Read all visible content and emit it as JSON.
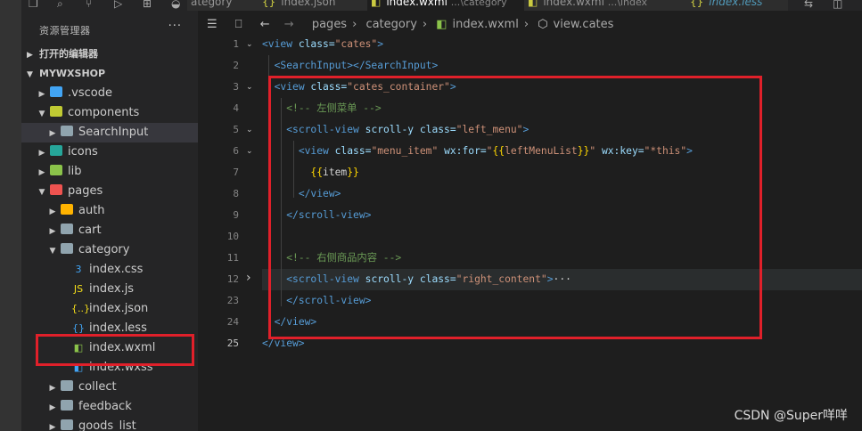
{
  "tabs": [
    {
      "label": "ategory",
      "active": false
    },
    {
      "label": "index.json",
      "icon": "{}",
      "active": false
    },
    {
      "label": "index.wxml",
      "suffix": "...\\category",
      "active": true
    },
    {
      "label": "index.wxml",
      "suffix": "...\\index",
      "active": false
    },
    {
      "label": "index.less",
      "active": false
    }
  ],
  "sidebar": {
    "title": "资源管理器",
    "more": "···",
    "open_editors": "打开的编辑器",
    "project": "MYWXSHOP",
    "items": [
      {
        "label": ".vscode",
        "depth": 1,
        "kind": "folder",
        "icon": "vscode-folder-icon",
        "expanded": false
      },
      {
        "label": "components",
        "depth": 1,
        "kind": "folder",
        "icon": "components-folder-icon",
        "expanded": true
      },
      {
        "label": "SearchInput",
        "depth": 2,
        "kind": "folder",
        "icon": "folder-icon",
        "expanded": false,
        "selected": true
      },
      {
        "label": "icons",
        "depth": 1,
        "kind": "folder",
        "icon": "icons-folder-icon",
        "expanded": false
      },
      {
        "label": "lib",
        "depth": 1,
        "kind": "folder",
        "icon": "lib-folder-icon",
        "expanded": false
      },
      {
        "label": "pages",
        "depth": 1,
        "kind": "folder",
        "icon": "pages-folder-icon",
        "expanded": true
      },
      {
        "label": "auth",
        "depth": 2,
        "kind": "folder",
        "icon": "auth-folder-icon",
        "expanded": false
      },
      {
        "label": "cart",
        "depth": 2,
        "kind": "folder",
        "icon": "folder-icon",
        "expanded": false
      },
      {
        "label": "category",
        "depth": 2,
        "kind": "folder",
        "icon": "folder-open-icon",
        "expanded": true
      },
      {
        "label": "index.css",
        "depth": 3,
        "kind": "file",
        "icon": "css-file-icon",
        "glyph": "3",
        "color": "#42a5f5"
      },
      {
        "label": "index.js",
        "depth": 3,
        "kind": "file",
        "icon": "js-file-icon",
        "glyph": "JS",
        "color": "#f5de19"
      },
      {
        "label": "index.json",
        "depth": 3,
        "kind": "file",
        "icon": "json-file-icon",
        "glyph": "{..}",
        "color": "#f5de19"
      },
      {
        "label": "index.less",
        "depth": 3,
        "kind": "file",
        "icon": "less-file-icon",
        "glyph": "{}",
        "color": "#42a5f5"
      },
      {
        "label": "index.wxml",
        "depth": 3,
        "kind": "file",
        "icon": "wxml-file-icon",
        "glyph": "◧",
        "color": "#8bc34a"
      },
      {
        "label": "index.wxss",
        "depth": 3,
        "kind": "file",
        "icon": "wxss-file-icon",
        "glyph": "◧",
        "color": "#42a5f5"
      },
      {
        "label": "collect",
        "depth": 2,
        "kind": "folder",
        "icon": "folder-icon",
        "expanded": false
      },
      {
        "label": "feedback",
        "depth": 2,
        "kind": "folder",
        "icon": "folder-icon",
        "expanded": false
      },
      {
        "label": "goods_list",
        "depth": 2,
        "kind": "folder",
        "icon": "folder-icon",
        "expanded": false
      }
    ]
  },
  "breadcrumb": [
    "pages",
    "category",
    "index.wxml",
    "view.cates"
  ],
  "editor": {
    "lines": [
      {
        "num": "1",
        "fold": true,
        "indent": 0,
        "tokens": [
          [
            "tag",
            "<view "
          ],
          [
            "attr",
            "class="
          ],
          [
            "str",
            "\"cates\""
          ],
          [
            "tag",
            ">"
          ]
        ]
      },
      {
        "num": "2",
        "fold": false,
        "indent": 1,
        "tokens": [
          [
            "tag",
            "<SearchInput></SearchInput>"
          ]
        ]
      },
      {
        "num": "3",
        "fold": true,
        "indent": 1,
        "tokens": [
          [
            "tag",
            "<view "
          ],
          [
            "attr",
            "class="
          ],
          [
            "str",
            "\"cates_container\""
          ],
          [
            "tag",
            ">"
          ]
        ]
      },
      {
        "num": "4",
        "fold": false,
        "indent": 2,
        "tokens": [
          [
            "cmt",
            "<!-- 左侧菜单 -->"
          ]
        ]
      },
      {
        "num": "5",
        "fold": true,
        "indent": 2,
        "tokens": [
          [
            "tag",
            "<scroll-view "
          ],
          [
            "attr",
            "scroll-y class="
          ],
          [
            "str",
            "\"left_menu\""
          ],
          [
            "tag",
            ">"
          ]
        ]
      },
      {
        "num": "6",
        "fold": true,
        "indent": 3,
        "tokens": [
          [
            "tag",
            "<view "
          ],
          [
            "attr",
            "class="
          ],
          [
            "str",
            "\"menu_item\" "
          ],
          [
            "attr",
            "wx:for="
          ],
          [
            "str",
            "\""
          ],
          [
            "brace",
            "{{"
          ],
          [
            "str",
            "leftMenuList"
          ],
          [
            "brace",
            "}}"
          ],
          [
            "str",
            "\" "
          ],
          [
            "attr",
            "wx:key="
          ],
          [
            "str",
            "\"*this\""
          ],
          [
            "tag",
            ">"
          ]
        ]
      },
      {
        "num": "7",
        "fold": false,
        "indent": 4,
        "tokens": [
          [
            "brace",
            "{{"
          ],
          [
            "txt",
            "item"
          ],
          [
            "brace",
            "}}"
          ]
        ]
      },
      {
        "num": "8",
        "fold": false,
        "indent": 3,
        "tokens": [
          [
            "tag",
            "</view>"
          ]
        ]
      },
      {
        "num": "9",
        "fold": false,
        "indent": 2,
        "tokens": [
          [
            "tag",
            "</scroll-view>"
          ]
        ]
      },
      {
        "num": "10",
        "fold": false,
        "indent": 0,
        "tokens": []
      },
      {
        "num": "11",
        "fold": false,
        "indent": 2,
        "tokens": [
          [
            "cmt",
            "<!-- 右侧商品内容 -->"
          ]
        ]
      },
      {
        "num": "12",
        "fold": true,
        "folded": true,
        "indent": 2,
        "tokens": [
          [
            "tag",
            "<scroll-view "
          ],
          [
            "attr",
            "scroll-y class="
          ],
          [
            "str",
            "\"right_content\""
          ],
          [
            "tag",
            ">"
          ],
          [
            "txt",
            "···"
          ]
        ]
      },
      {
        "num": "23",
        "fold": false,
        "indent": 2,
        "tokens": [
          [
            "tag",
            "</scroll-view>"
          ]
        ]
      },
      {
        "num": "24",
        "fold": false,
        "indent": 1,
        "tokens": [
          [
            "tag",
            "</view>"
          ]
        ]
      },
      {
        "num": "25",
        "fold": false,
        "indent": 0,
        "current": true,
        "tokens": [
          [
            "tag",
            "</view>"
          ]
        ]
      }
    ]
  },
  "watermark": "CSDN @Super咩咩"
}
